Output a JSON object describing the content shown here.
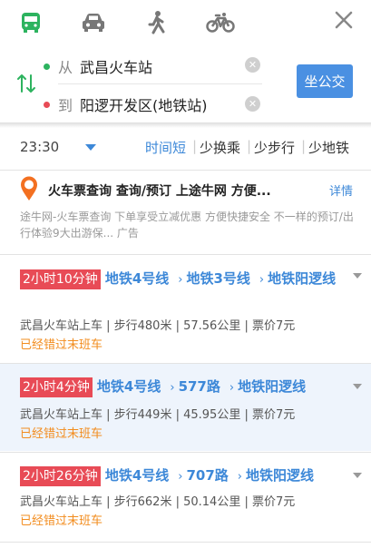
{
  "modes": [
    {
      "name": "bus",
      "active": true
    },
    {
      "name": "car",
      "active": false
    },
    {
      "name": "walk",
      "active": false
    },
    {
      "name": "bike",
      "active": false
    }
  ],
  "route": {
    "from_prefix": "从",
    "from": "武昌火车站",
    "to_prefix": "到",
    "to": "阳逻开发区(地铁站)",
    "go_label": "坐公交"
  },
  "filter": {
    "time": "23:30",
    "options": [
      "时间短",
      "少换乘",
      "少步行",
      "少地铁"
    ],
    "selected": "时间短"
  },
  "ad": {
    "title": "火车票查询 查询/预订 上途牛网 方便...",
    "more": "详情",
    "desc": "途牛网-火车票查询 下单享受立减优惠 方便快捷安全 不一样的预订/出行体验9大出游保... 广告"
  },
  "routes": [
    {
      "duration": "2小时10分钟",
      "lines": [
        "地铁4号线",
        "地铁3号线",
        "地铁阳逻线"
      ],
      "info": "武昌火车站上车 | 步行480米 | 57.56公里 | 票价7元",
      "status": "已经错过末班车"
    },
    {
      "duration": "2小时4分钟",
      "lines": [
        "地铁4号线",
        "577路",
        "地铁阳逻线"
      ],
      "info": "武昌火车站上车 | 步行449米 | 45.95公里 | 票价7元",
      "status": "已经错过末班车"
    },
    {
      "duration": "2小时26分钟",
      "lines": [
        "地铁4号线",
        "707路",
        "地铁阳逻线"
      ],
      "info": "武昌火车站上车 | 步行662米 | 50.14公里 | 票价7元",
      "status": "已经错过末班车"
    }
  ],
  "colors": {
    "accent": "#3d88d8",
    "duration_bg": "#e84b56",
    "active_mode": "#2db35f",
    "missed": "#f28c1e",
    "button": "#4a90e2"
  }
}
